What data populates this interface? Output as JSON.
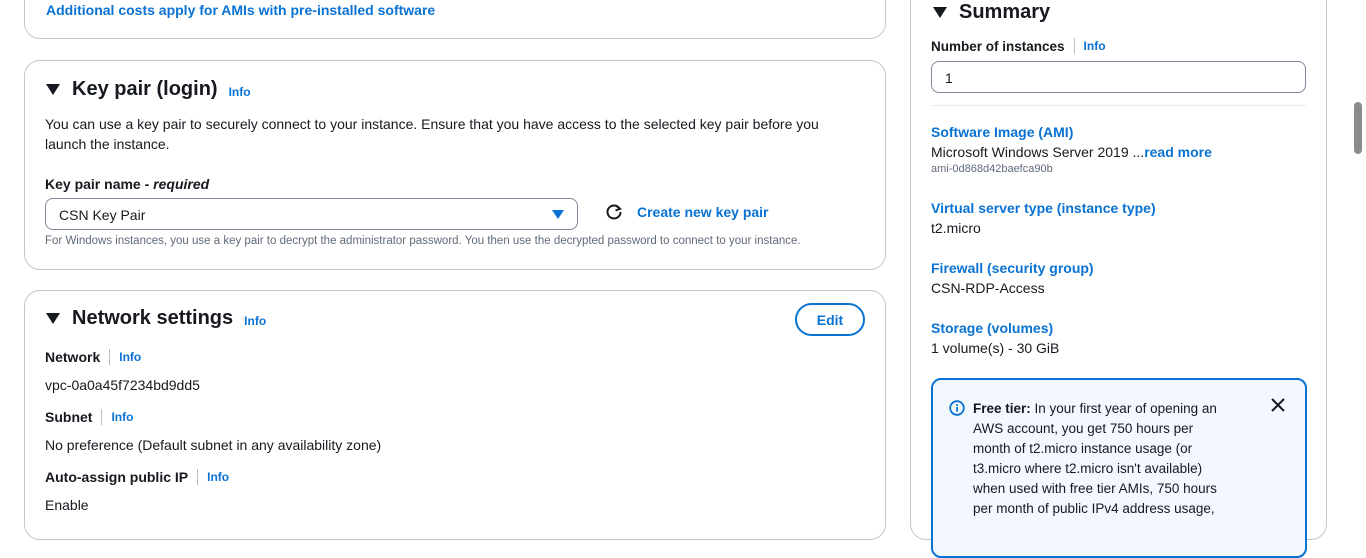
{
  "top_notice": {
    "link_text": "Additional costs apply for AMIs with pre-installed software"
  },
  "key_pair": {
    "title": "Key pair (login)",
    "info": "Info",
    "description": "You can use a key pair to securely connect to your instance. Ensure that you have access to the selected key pair before you launch the instance.",
    "field_label": "Key pair name",
    "required_text": " - required",
    "selected_value": "CSN Key Pair",
    "create_link": "Create new key pair",
    "help_text": "For Windows instances, you use a key pair to decrypt the administrator password. You then use the decrypted password to connect to your instance."
  },
  "network_settings": {
    "title": "Network settings",
    "info": "Info",
    "edit_button": "Edit",
    "network_label": "Network",
    "network_info": "Info",
    "network_value": "vpc-0a0a45f7234bd9dd5",
    "subnet_label": "Subnet",
    "subnet_info": "Info",
    "subnet_value": "No preference (Default subnet in any availability zone)",
    "public_ip_label": "Auto-assign public IP",
    "public_ip_info": "Info",
    "public_ip_value": "Enable"
  },
  "summary": {
    "title": "Summary",
    "instances_label": "Number of instances",
    "instances_info": "Info",
    "instances_value": "1",
    "ami_label": "Software Image (AMI)",
    "ami_value": "Microsoft Windows Server 2019 ...",
    "ami_read_more": "read more",
    "ami_id": "ami-0d868d42baefca90b",
    "type_label": "Virtual server type (instance type)",
    "type_value": "t2.micro",
    "firewall_label": "Firewall (security group)",
    "firewall_value": "CSN-RDP-Access",
    "storage_label": "Storage (volumes)",
    "storage_value": "1 volume(s) - 30 GiB",
    "free_tier_bold": "Free tier:",
    "free_tier_lines": [
      " In your first year of opening an",
      "AWS account, you get 750 hours per",
      "month of t2.micro instance usage (or",
      "t3.micro where t2.micro isn't available)",
      "when used with free tier AMIs, 750 hours",
      "per month of public IPv4 address usage,"
    ]
  },
  "icons": {
    "collapse": "caret-down-icon",
    "refresh": "refresh-icon",
    "info": "info-circle-icon",
    "close": "close-icon"
  },
  "colors": {
    "link": "#0972d3",
    "text": "#16191f",
    "border": "#c6c6cd",
    "alert_bg": "#f2f8fd"
  }
}
